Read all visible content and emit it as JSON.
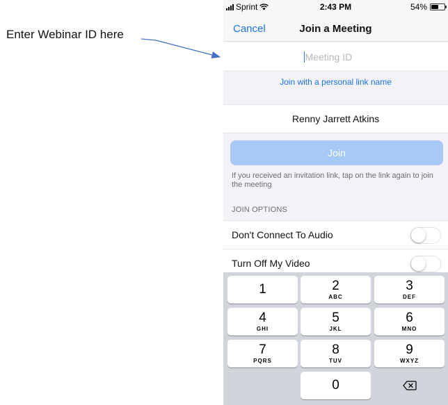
{
  "annotation": {
    "text": "Enter Webinar ID here"
  },
  "status_bar": {
    "carrier": "Sprint",
    "time": "2:43 PM",
    "battery_percent": "54%",
    "battery_level": 0.54
  },
  "nav": {
    "cancel_label": "Cancel",
    "title": "Join a Meeting"
  },
  "meeting_id": {
    "placeholder": "Meeting ID",
    "value": ""
  },
  "personal_link": {
    "label": "Join with a personal link name"
  },
  "name_field": {
    "value": "Renny Jarrett Atkins"
  },
  "join": {
    "label": "Join",
    "color": "#a7c9f6"
  },
  "hint": {
    "text": "If you received an invitation link, tap on the link again to join the meeting"
  },
  "join_options": {
    "header": "JOIN OPTIONS",
    "items": [
      {
        "label": "Don't Connect To Audio",
        "on": false
      },
      {
        "label": "Turn Off My Video",
        "on": false
      }
    ]
  },
  "keypad": {
    "keys": [
      {
        "digit": "1",
        "letters": ""
      },
      {
        "digit": "2",
        "letters": "ABC"
      },
      {
        "digit": "3",
        "letters": "DEF"
      },
      {
        "digit": "4",
        "letters": "GHI"
      },
      {
        "digit": "5",
        "letters": "JKL"
      },
      {
        "digit": "6",
        "letters": "MNO"
      },
      {
        "digit": "7",
        "letters": "PQRS"
      },
      {
        "digit": "8",
        "letters": "TUV"
      },
      {
        "digit": "9",
        "letters": "WXYZ"
      },
      {
        "digit": "0",
        "letters": ""
      }
    ],
    "backspace_icon": "backspace-icon"
  },
  "colors": {
    "accent": "#1a73e8",
    "arrow": "#4472c4",
    "keyboard_bg": "#d1d4db"
  }
}
